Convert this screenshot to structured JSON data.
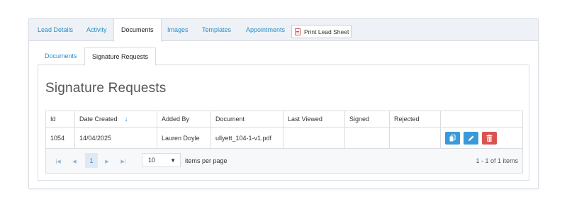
{
  "top_tabs": [
    {
      "label": "Lead Details"
    },
    {
      "label": "Activity"
    },
    {
      "label": "Documents"
    },
    {
      "label": "Images"
    },
    {
      "label": "Templates"
    },
    {
      "label": "Appointments"
    }
  ],
  "print_button": {
    "label": "Print Lead Sheet",
    "icon": "pdf-icon"
  },
  "sub_tabs": [
    {
      "label": "Documents"
    },
    {
      "label": "Signature Requests"
    }
  ],
  "page_title": "Signature Requests",
  "grid": {
    "columns": [
      "Id",
      "Date Created",
      "Added By",
      "Document",
      "Last Viewed",
      "Signed",
      "Rejected",
      ""
    ],
    "rows": [
      {
        "id": "1054",
        "date_created": "14/04/2025",
        "added_by": "Lauren Doyle",
        "document": "ullyett_104-1-v1.pdf",
        "last_viewed": "",
        "signed": "",
        "rejected": ""
      }
    ],
    "actions": [
      "copy-icon",
      "edit-icon",
      "delete-icon"
    ]
  },
  "pager": {
    "current_page": "1",
    "per_page": "10",
    "per_page_label": "items per page",
    "info": "1 - 1 of 1 items"
  },
  "colors": {
    "accent": "#2a8fc9",
    "button_blue": "#3a9ad9",
    "button_red": "#d9534f"
  }
}
